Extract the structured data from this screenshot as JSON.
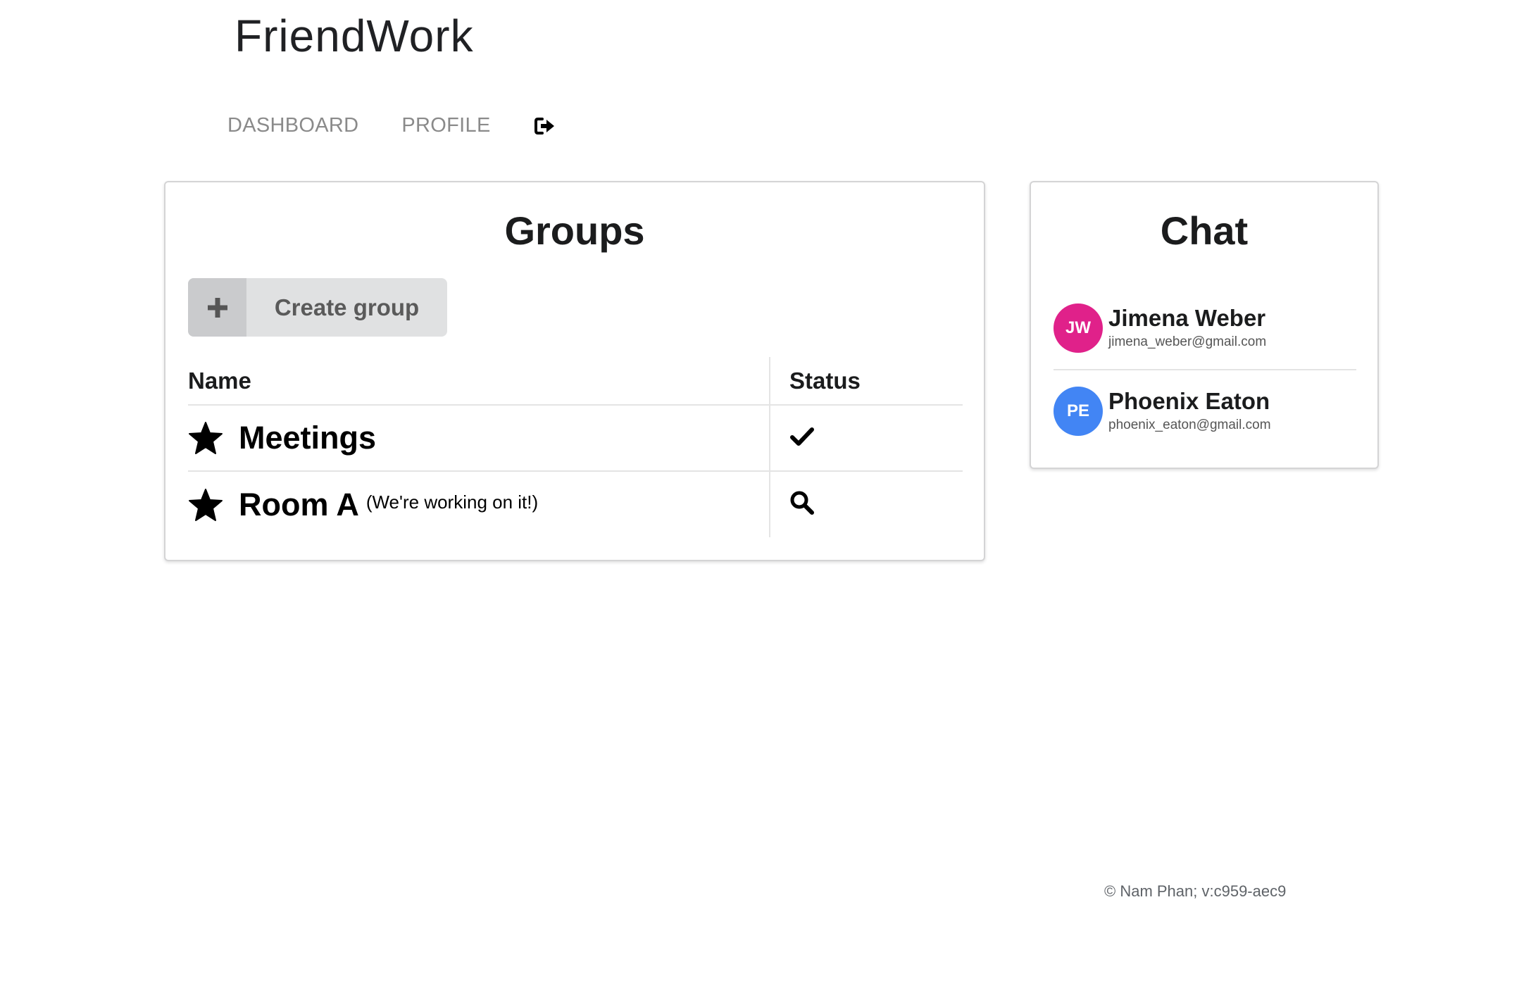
{
  "app": {
    "title": "FriendWork"
  },
  "nav": {
    "items": [
      {
        "label": "DASHBOARD"
      },
      {
        "label": "PROFILE"
      }
    ],
    "logout_icon": "sign-out-icon"
  },
  "groups": {
    "title": "Groups",
    "create_button": {
      "label": "Create group",
      "icon": "plus-icon"
    },
    "columns": {
      "name": "Name",
      "status": "Status"
    },
    "rows": [
      {
        "name": "Meetings",
        "note": "",
        "icon": "star-icon",
        "status_icon": "check-icon"
      },
      {
        "name": "Room A",
        "note": "(We're working on it!)",
        "icon": "star-icon",
        "status_icon": "search-icon"
      }
    ]
  },
  "chat": {
    "title": "Chat",
    "contacts": [
      {
        "initials": "JW",
        "name": "Jimena Weber",
        "email": "jimena_weber@gmail.com",
        "color": "#e0218a"
      },
      {
        "initials": "PE",
        "name": "Phoenix Eaton",
        "email": "phoenix_eaton@gmail.com",
        "color": "#4285f4"
      }
    ]
  },
  "footer": {
    "text": "© Nam Phan; v:c959-aec9"
  },
  "colors": {
    "create_button_bg": "#e0e1e2",
    "nav_text": "#8a8a8a"
  }
}
